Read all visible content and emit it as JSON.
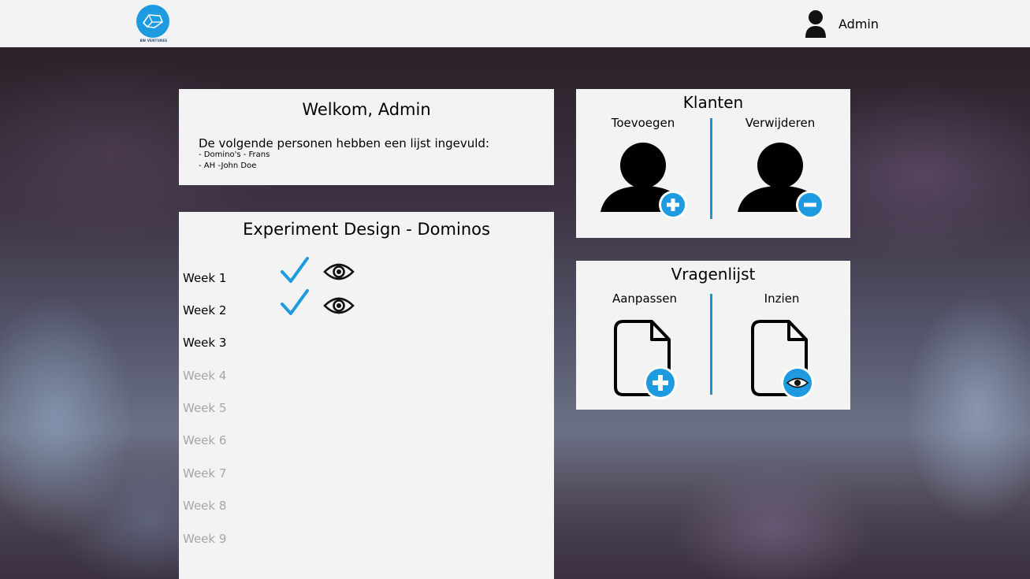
{
  "header": {
    "logo_text": "BW VENTURES",
    "user_name": "Admin"
  },
  "welcome": {
    "title": "Welkom, Admin",
    "intro": "De volgende personen hebben een lijst ingevuld:",
    "entries": [
      "- Domino's - Frans",
      "- AH -John Doe"
    ]
  },
  "experiment": {
    "title": "Experiment Design - Dominos",
    "weeks": [
      {
        "label": "Week 1",
        "done": true
      },
      {
        "label": "Week 2",
        "done": true
      },
      {
        "label": "Week 3",
        "done": false
      },
      {
        "label": "Week 4",
        "done": false
      },
      {
        "label": "Week 5",
        "done": false
      },
      {
        "label": "Week 6",
        "done": false
      },
      {
        "label": "Week 7",
        "done": false
      },
      {
        "label": "Week 8",
        "done": false
      },
      {
        "label": "Week 9",
        "done": false
      }
    ]
  },
  "klanten": {
    "title": "Klanten",
    "add_label": "Toevoegen",
    "remove_label": "Verwijderen"
  },
  "vragenlijst": {
    "title": "Vragenlijst",
    "edit_label": "Aanpassen",
    "view_label": "Inzien"
  },
  "colors": {
    "accent": "#1e9be0",
    "panel": "#f3f3f3",
    "muted_text": "#a6a6a6"
  }
}
